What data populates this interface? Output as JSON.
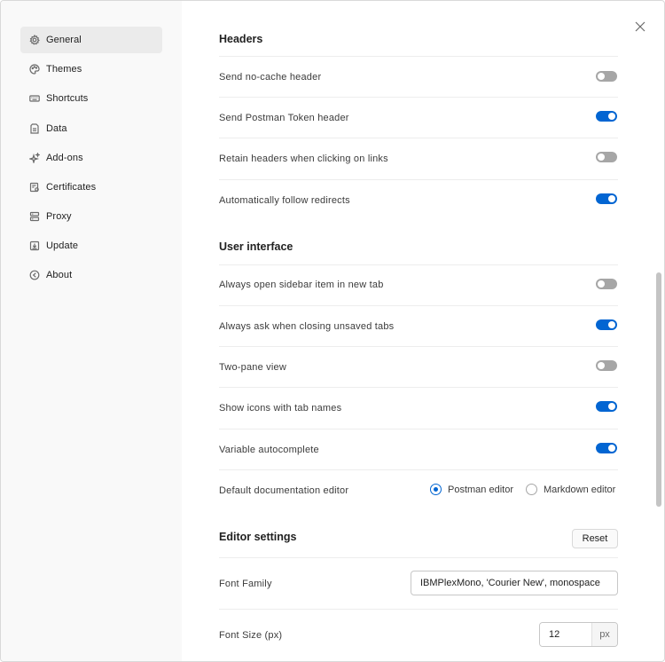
{
  "sidebar": {
    "items": [
      {
        "label": "General",
        "icon": "gear-icon",
        "active": true
      },
      {
        "label": "Themes",
        "icon": "palette-icon"
      },
      {
        "label": "Shortcuts",
        "icon": "keyboard-icon"
      },
      {
        "label": "Data",
        "icon": "data-icon"
      },
      {
        "label": "Add-ons",
        "icon": "sparkle-icon"
      },
      {
        "label": "Certificates",
        "icon": "certificate-icon"
      },
      {
        "label": "Proxy",
        "icon": "proxy-icon"
      },
      {
        "label": "Update",
        "icon": "download-icon"
      },
      {
        "label": "About",
        "icon": "about-icon"
      }
    ]
  },
  "headers": {
    "title": "Headers",
    "rows": [
      {
        "label": "Send no-cache header",
        "enabled": false
      },
      {
        "label": "Send Postman Token header",
        "enabled": true
      },
      {
        "label": "Retain headers when clicking on links",
        "enabled": false
      },
      {
        "label": "Automatically follow redirects",
        "enabled": true
      }
    ]
  },
  "ui": {
    "title": "User interface",
    "rows": [
      {
        "label": "Always open sidebar item in new tab",
        "enabled": false
      },
      {
        "label": "Always ask when closing unsaved tabs",
        "enabled": true
      },
      {
        "label": "Two-pane view",
        "enabled": false
      },
      {
        "label": "Show icons with tab names",
        "enabled": true
      },
      {
        "label": "Variable autocomplete",
        "enabled": true
      }
    ],
    "doc_editor": {
      "label": "Default documentation editor",
      "options": [
        "Postman editor",
        "Markdown editor"
      ],
      "selected": "Postman editor"
    }
  },
  "editor": {
    "title": "Editor settings",
    "reset_label": "Reset",
    "font_family_label": "Font Family",
    "font_family_value": "IBMPlexMono, 'Courier New', monospace",
    "font_size_label": "Font Size (px)",
    "font_size_value": "12",
    "font_size_unit": "px"
  },
  "colors": {
    "accent": "#0265d2",
    "toggle_off": "#a6a6a6",
    "sidebar_bg": "#f9f9f9",
    "active_item_bg": "#ebebeb"
  }
}
